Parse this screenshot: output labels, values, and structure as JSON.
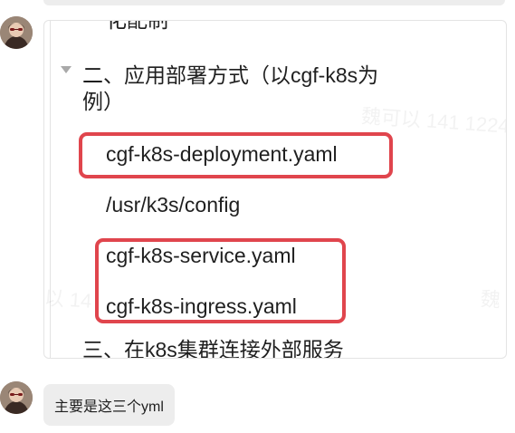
{
  "document": {
    "partial_top_text": "化配制",
    "section_heading": "二、应用部署方式（以cgf-k8s为",
    "section_heading_cont": "例）",
    "items": [
      "cgf-k8s-deployment.yaml",
      "/usr/k3s/config",
      "cgf-k8s-service.yaml",
      "cgf-k8s-ingress.yaml"
    ],
    "partial_bottom_text": "三、在k8s集群连接外部服务"
  },
  "message": {
    "text": "主要是这三个yml"
  },
  "colors": {
    "highlight": "#e0454d",
    "bubble_bg": "#ededed",
    "text": "#1f1f1f"
  },
  "icons": {
    "collapse": "triangle-down-icon",
    "avatar": "avatar-photo"
  }
}
